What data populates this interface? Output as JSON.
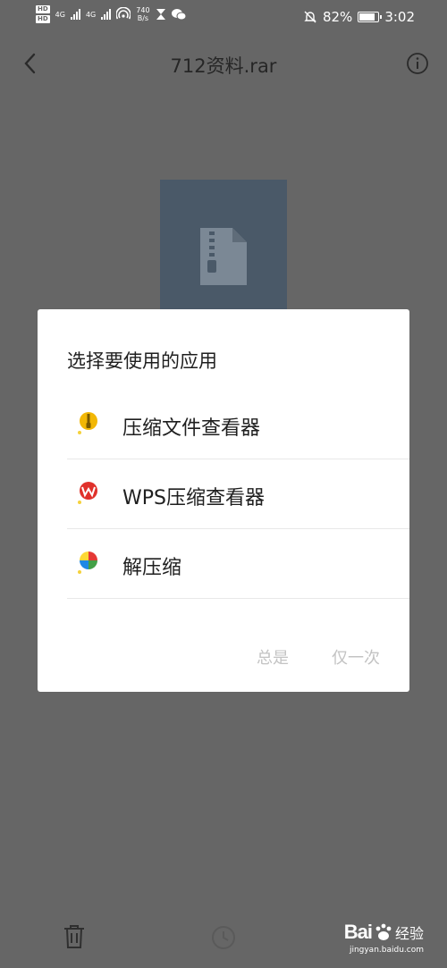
{
  "status_bar": {
    "hd_top": "HD",
    "hd_bottom": "HD",
    "net1": "4G",
    "net2": "4G",
    "rate_value": "740",
    "rate_unit": "B/s",
    "battery": "82%",
    "time": "3:02"
  },
  "header": {
    "title": "712资料.rar"
  },
  "dialog": {
    "title": "选择要使用的应用",
    "apps": [
      {
        "label": "压缩文件查看器",
        "icon": "zip-viewer-icon"
      },
      {
        "label": "WPS压缩查看器",
        "icon": "wps-icon"
      },
      {
        "label": "解压缩",
        "icon": "unzip-icon"
      }
    ],
    "always_label": "总是",
    "once_label": "仅一次"
  },
  "watermark": {
    "brand": "Bai",
    "suffix": "经验",
    "url": "jingyan.baidu.com"
  },
  "colors": {
    "overlay": "#666666",
    "dialog_bg": "#ffffff",
    "thumb": "#4a5968",
    "disabled_text": "#c3c3c3"
  }
}
